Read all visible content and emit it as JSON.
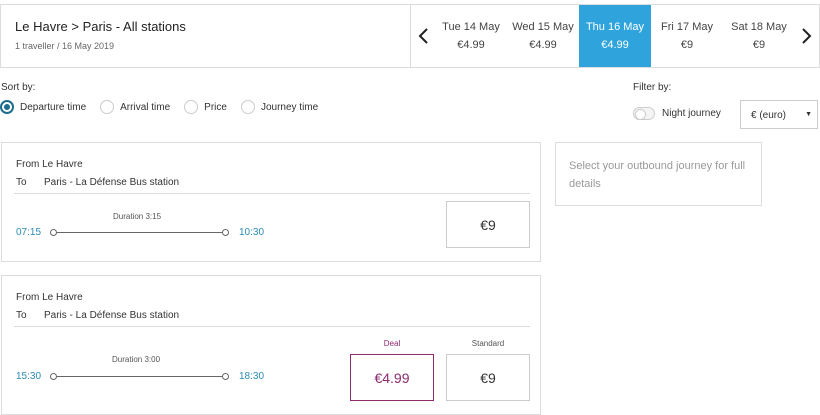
{
  "header": {
    "route": "Le Havre > Paris - All stations",
    "subroute": "1 traveller / 16 May 2019",
    "prev_icon": "chevron-left-icon",
    "next_icon": "chevron-right-icon",
    "days": [
      {
        "date": "Tue 14 May",
        "price": "€4.99",
        "selected": false
      },
      {
        "date": "Wed 15 May",
        "price": "€4.99",
        "selected": false
      },
      {
        "date": "Thu 16 May",
        "price": "€4.99",
        "selected": true
      },
      {
        "date": "Fri 17 May",
        "price": "€9",
        "selected": false
      },
      {
        "date": "Sat 18 May",
        "price": "€9",
        "selected": false
      }
    ]
  },
  "sort": {
    "label": "Sort by:",
    "options": [
      {
        "label": "Departure time",
        "selected": true
      },
      {
        "label": "Arrival time",
        "selected": false
      },
      {
        "label": "Price",
        "selected": false
      },
      {
        "label": "Journey time",
        "selected": false
      }
    ]
  },
  "filter": {
    "label": "Filter by:",
    "night_journey": "Night journey",
    "night_journey_on": false,
    "currency": "€ (euro)"
  },
  "journeys": [
    {
      "from_label": "From",
      "from": "Le Havre",
      "to_label": "To",
      "to": "Paris - La Défense Bus station",
      "duration": "Duration 3:15",
      "depart": "07:15",
      "arrive": "10:30",
      "standard_price": "€9"
    },
    {
      "from_label": "From",
      "from": "Le Havre",
      "to_label": "To",
      "to": "Paris - La Défense Bus station",
      "duration": "Duration 3:00",
      "depart": "15:30",
      "arrive": "18:30",
      "deal_label": "Deal",
      "deal_price": "€4.99",
      "standard_label": "Standard",
      "standard_price": "€9"
    }
  ],
  "side_panel": {
    "message": "Select your outbound journey for full details"
  },
  "colors": {
    "selected_day": "#2fa4dc",
    "time": "#2b8ab5",
    "deal": "#8e2a6d",
    "radio_selected": "#1c6d8f"
  }
}
